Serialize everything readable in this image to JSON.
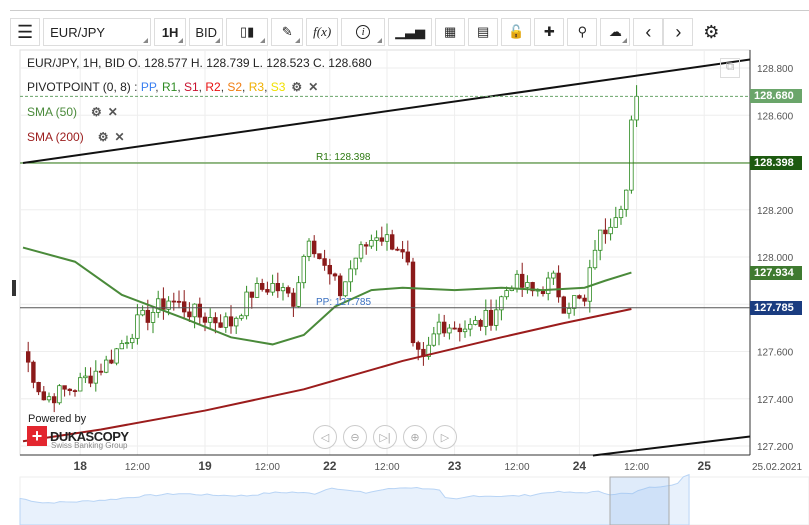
{
  "toolbar": {
    "menu_icon": "menu-icon",
    "instrument": "EUR/JPY",
    "period": "1H",
    "side": "BID",
    "icons": [
      "candles-icon",
      "pencil-icon",
      "function-icon",
      "info-icon",
      "bar-chart-icon",
      "calendar-icon",
      "news-icon",
      "lock-icon",
      "crosshair-icon",
      "zoom-search-icon",
      "cloud-upload-icon",
      "chevron-left-icon",
      "chevron-right-icon",
      "gear-icon"
    ],
    "fx_label": "f(x)"
  },
  "legend": {
    "ohlc": "EUR/JPY, 1H, BID   O. 128.577 H. 128.739 L. 128.523 C. 128.680",
    "pivot": "PIVOTPOINT (0, 8)",
    "pivot_items": [
      {
        "t": " : ",
        "c": "#333"
      },
      {
        "t": "PP",
        "c": "#3a7ff0"
      },
      {
        "t": ", ",
        "c": "#333"
      },
      {
        "t": "R1",
        "c": "#2e8b22"
      },
      {
        "t": ", ",
        "c": "#333"
      },
      {
        "t": "S1",
        "c": "#c8102e"
      },
      {
        "t": ", ",
        "c": "#333"
      },
      {
        "t": "R2",
        "c": "#e81010"
      },
      {
        "t": ", ",
        "c": "#333"
      },
      {
        "t": "S2",
        "c": "#f07c10"
      },
      {
        "t": ", ",
        "c": "#333"
      },
      {
        "t": "R3",
        "c": "#f0b000"
      },
      {
        "t": ", ",
        "c": "#333"
      },
      {
        "t": "S3",
        "c": "#f0e000"
      }
    ],
    "sma50": "SMA (50)",
    "sma200": "SMA (200)"
  },
  "powered": "Powered by",
  "brand": "DUKASCOPY",
  "brand_sub": "Swiss Banking Group",
  "colors": {
    "up": "#2e8b22",
    "down": "#8b1a1a",
    "sma50": "#4a8a3a",
    "sma200": "#9b1c1c",
    "last": "#6aa56a",
    "r1": "#2e7a12",
    "pp": "#3a70c0"
  },
  "chart_data": {
    "type": "candlestick",
    "y_ticks": [
      "128.800",
      "128.600",
      "128.400",
      "128.200",
      "128.000",
      "127.800",
      "127.600",
      "127.400",
      "127.200"
    ],
    "ylim": [
      127.16,
      128.85
    ],
    "x_ticks": [
      {
        "h": 11,
        "t": "18",
        "b": true
      },
      {
        "h": 22,
        "t": "12:00"
      },
      {
        "h": 35,
        "t": "19",
        "b": true
      },
      {
        "h": 47,
        "t": "12:00"
      },
      {
        "h": 59,
        "t": "22",
        "b": true
      },
      {
        "h": 70,
        "t": "12:00"
      },
      {
        "h": 83,
        "t": "23",
        "b": true
      },
      {
        "h": 95,
        "t": "12:00"
      },
      {
        "h": 107,
        "t": "24",
        "b": true
      },
      {
        "h": 118,
        "t": "12:00"
      },
      {
        "h": 131,
        "t": "25",
        "b": true
      },
      {
        "h": 145,
        "t": "25.02.2021"
      }
    ],
    "price_keypoints": [
      [
        0,
        127.6
      ],
      [
        4,
        127.4
      ],
      [
        10,
        127.45
      ],
      [
        16,
        127.55
      ],
      [
        22,
        127.72
      ],
      [
        28,
        127.82
      ],
      [
        34,
        127.75
      ],
      [
        40,
        127.72
      ],
      [
        44,
        127.85
      ],
      [
        48,
        127.88
      ],
      [
        52,
        127.82
      ],
      [
        55,
        128.1
      ],
      [
        58,
        127.95
      ],
      [
        61,
        127.85
      ],
      [
        64,
        128.0
      ],
      [
        68,
        128.1
      ],
      [
        72,
        128.05
      ],
      [
        74,
        127.95
      ],
      [
        75,
        127.6
      ],
      [
        77,
        127.55
      ],
      [
        80,
        127.72
      ],
      [
        86,
        127.7
      ],
      [
        90,
        127.75
      ],
      [
        94,
        127.9
      ],
      [
        98,
        127.85
      ],
      [
        102,
        127.9
      ],
      [
        104,
        127.8
      ],
      [
        106,
        127.82
      ],
      [
        108,
        127.8
      ],
      [
        110,
        128.05
      ],
      [
        114,
        128.2
      ],
      [
        116,
        128.28
      ],
      [
        117,
        128.58
      ],
      [
        118,
        128.68
      ]
    ],
    "last_price": "128.680",
    "pivot_levels": [
      {
        "name": "R1",
        "value": 128.398,
        "label": "R1: 128.398",
        "tag": "128.398"
      },
      {
        "name": "PP",
        "value": 127.785,
        "label": "PP: 127.785",
        "tag": "127.785"
      }
    ],
    "sma50": [
      [
        0,
        128.04
      ],
      [
        10,
        127.98
      ],
      [
        19,
        127.84
      ],
      [
        31,
        127.74
      ],
      [
        40,
        127.66
      ],
      [
        48,
        127.63
      ],
      [
        54,
        127.67
      ],
      [
        60,
        127.79
      ],
      [
        67,
        127.86
      ],
      [
        73,
        127.87
      ],
      [
        83,
        127.86
      ],
      [
        92,
        127.87
      ],
      [
        100,
        127.86
      ],
      [
        108,
        127.87
      ],
      [
        112,
        127.9
      ],
      [
        117,
        127.934
      ]
    ],
    "sma50_tag": "127.934",
    "sma200": [
      [
        0,
        127.22
      ],
      [
        15,
        127.27
      ],
      [
        35,
        127.35
      ],
      [
        54,
        127.44
      ],
      [
        73,
        127.56
      ],
      [
        92,
        127.66
      ],
      [
        104,
        127.72
      ],
      [
        117,
        127.78
      ]
    ],
    "trendlines": [
      [
        [
          0,
          128.398
        ],
        [
          140,
          128.836
        ]
      ],
      [
        [
          109.6,
          127.16
        ],
        [
          140,
          127.24
        ]
      ]
    ]
  }
}
